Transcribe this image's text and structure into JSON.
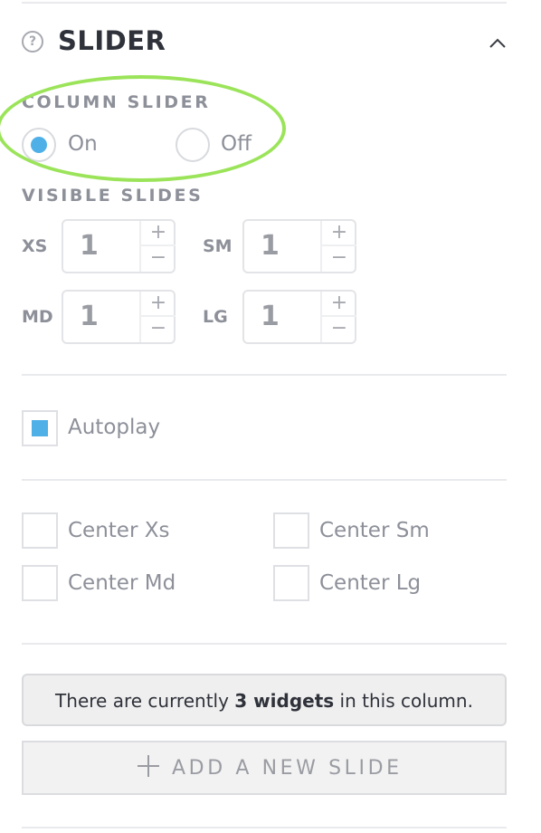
{
  "panel": {
    "title": "SLIDER",
    "help_icon": "question-circle-icon",
    "collapse_icon": "chevron-up-icon",
    "help_glyph": "?"
  },
  "column_slider": {
    "label": "COLUMN SLIDER",
    "options": [
      {
        "label": "On",
        "selected": true
      },
      {
        "label": "Off",
        "selected": false
      }
    ]
  },
  "visible_slides": {
    "label": "VISIBLE SLIDES",
    "sizes": [
      {
        "label": "XS",
        "value": "1"
      },
      {
        "label": "SM",
        "value": "1"
      },
      {
        "label": "MD",
        "value": "1"
      },
      {
        "label": "LG",
        "value": "1"
      }
    ],
    "increment_glyph": "+",
    "decrement_glyph": "−"
  },
  "autoplay": {
    "label": "Autoplay",
    "checked": true
  },
  "centering": [
    {
      "label": "Center Xs",
      "checked": false
    },
    {
      "label": "Center Sm",
      "checked": false
    },
    {
      "label": "Center Md",
      "checked": false
    },
    {
      "label": "Center Lg",
      "checked": false
    }
  ],
  "info": {
    "prefix": "There are currently ",
    "count_text": "3 widgets",
    "suffix": " in this column."
  },
  "add_slide": {
    "label": "ADD A NEW SLIDE",
    "icon": "plus-icon"
  },
  "colors": {
    "accent": "#4fb0e8",
    "highlight": "#9be45a",
    "title": "#2f323a",
    "muted": "#8d9099"
  }
}
